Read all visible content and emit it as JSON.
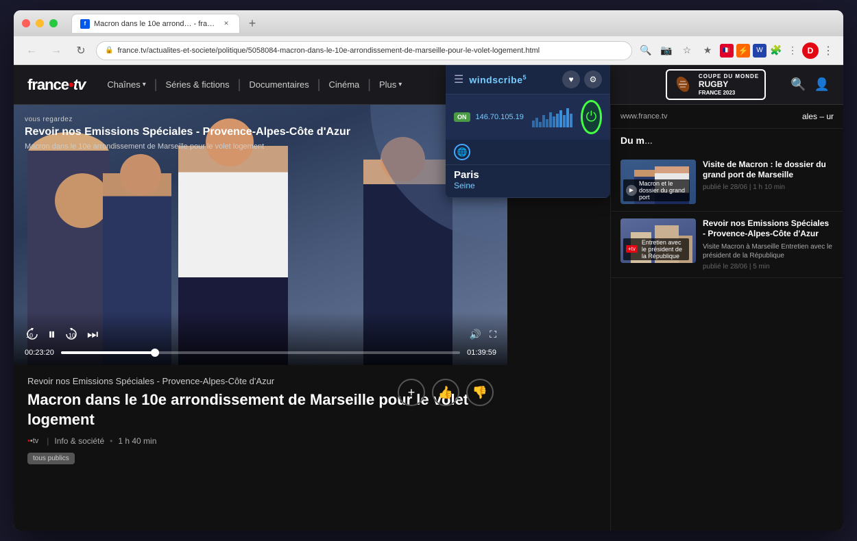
{
  "window": {
    "title": "Macron dans le 10e arrond… - france.tv",
    "url": "france.tv/actualites-et-societe/politique/5058084-macron-dans-le-10e-arrondissement-de-marseille-pour-le-volet-logement.html"
  },
  "nav": {
    "logo": "france",
    "logo_dot": "•",
    "logo_tv": "tv",
    "chains_label": "Chaînes",
    "series_label": "Séries & fictions",
    "docs_label": "Documentaires",
    "cinema_label": "Cinéma",
    "plus_label": "Plus",
    "rugby_coupe": "COUPE DU MONDE",
    "rugby_label": "RUGBY",
    "rugby_year": "FRANCE 2023"
  },
  "player": {
    "vous_regardez": "vous regardez",
    "show_title": "Revoir nos Emissions Spéciales - Provence-Alpes-Côte d'Azur",
    "episode_subtitle": "Macron dans le 10e arrondissement de Marseille pour le volet logement",
    "time_current": "00:23:20",
    "time_total": "01:39:59",
    "progress_percent": 23.5
  },
  "below_video": {
    "series_name": "Revoir nos Emissions Spéciales - Provence-Alpes-Côte d'Azur",
    "episode_title": "Macron dans le 10e arrondissement de Marseille pour le volet logement",
    "channel": "•tv",
    "category": "Info & société",
    "duration": "1 h 40 min",
    "audience": "tous publics"
  },
  "ftv_sidebar": {
    "site_label": "www.france.tv",
    "header_partial": "ales – ur",
    "card1": {
      "title": "Visite de Macron : le dossier du grand port de Marseille",
      "thumb_label": "Macron et le dossier du grand port",
      "description": "",
      "date": "publié le 28/06 | 1 h 10 min"
    },
    "card2": {
      "title": "Revoir nos Emissions Spéciales - Provence-Alpes-Côte d'Azur",
      "thumb_label": "Entretien avec le président de la République",
      "description": "Visite Macron à Marseille Entretien avec le président de la République",
      "date": "publié le 28/06 | 5 min"
    }
  },
  "windscribe": {
    "logo": "windscribe",
    "superscript": "5",
    "status": "ON",
    "ip": "146.70.105.19",
    "city": "Paris",
    "region": "Seine",
    "heart_icon": "♥",
    "settings_icon": "⚙"
  },
  "toolbar": {
    "back_label": "←",
    "forward_label": "→",
    "refresh_label": "↻",
    "search_icon": "🔍",
    "bookmark_icon": "☆",
    "extensions_icon": "🧩",
    "profile_icon": "D"
  }
}
